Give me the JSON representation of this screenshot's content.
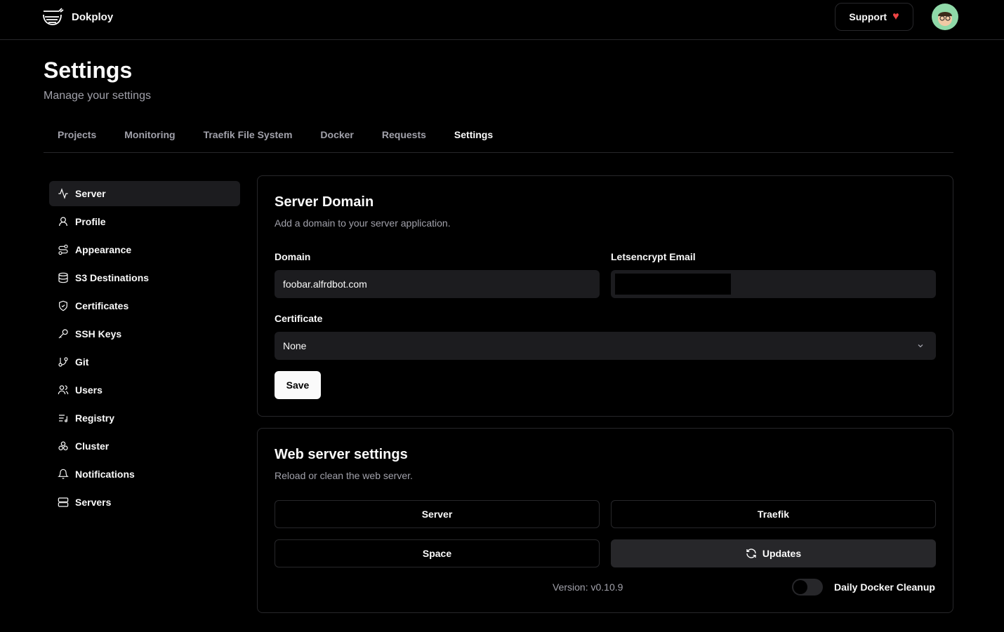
{
  "app": {
    "name": "Dokploy",
    "support": "Support"
  },
  "page": {
    "title": "Settings",
    "subtitle": "Manage your settings"
  },
  "tabs": [
    "Projects",
    "Monitoring",
    "Traefik File System",
    "Docker",
    "Requests",
    "Settings"
  ],
  "sidebar": [
    {
      "label": "Server",
      "icon": "activity-icon"
    },
    {
      "label": "Profile",
      "icon": "user-icon"
    },
    {
      "label": "Appearance",
      "icon": "route-icon"
    },
    {
      "label": "S3 Destinations",
      "icon": "database-icon"
    },
    {
      "label": "Certificates",
      "icon": "shield-check-icon"
    },
    {
      "label": "SSH Keys",
      "icon": "key-icon"
    },
    {
      "label": "Git",
      "icon": "git-branch-icon"
    },
    {
      "label": "Users",
      "icon": "users-icon"
    },
    {
      "label": "Registry",
      "icon": "list-music-icon"
    },
    {
      "label": "Cluster",
      "icon": "boxes-icon"
    },
    {
      "label": "Notifications",
      "icon": "bell-icon"
    },
    {
      "label": "Servers",
      "icon": "server-icon"
    }
  ],
  "domain_card": {
    "title": "Server Domain",
    "description": "Add a domain to your server application.",
    "domain_label": "Domain",
    "domain_value": "foobar.alfrdbot.com",
    "email_label": "Letsencrypt Email",
    "certificate_label": "Certificate",
    "certificate_value": "None",
    "save": "Save"
  },
  "web_card": {
    "title": "Web server settings",
    "description": "Reload or clean the web server.",
    "server": "Server",
    "traefik": "Traefik",
    "space": "Space",
    "updates": "Updates",
    "version": "Version: v0.10.9",
    "cleanup_label": "Daily Docker Cleanup",
    "cleanup_enabled": false
  }
}
